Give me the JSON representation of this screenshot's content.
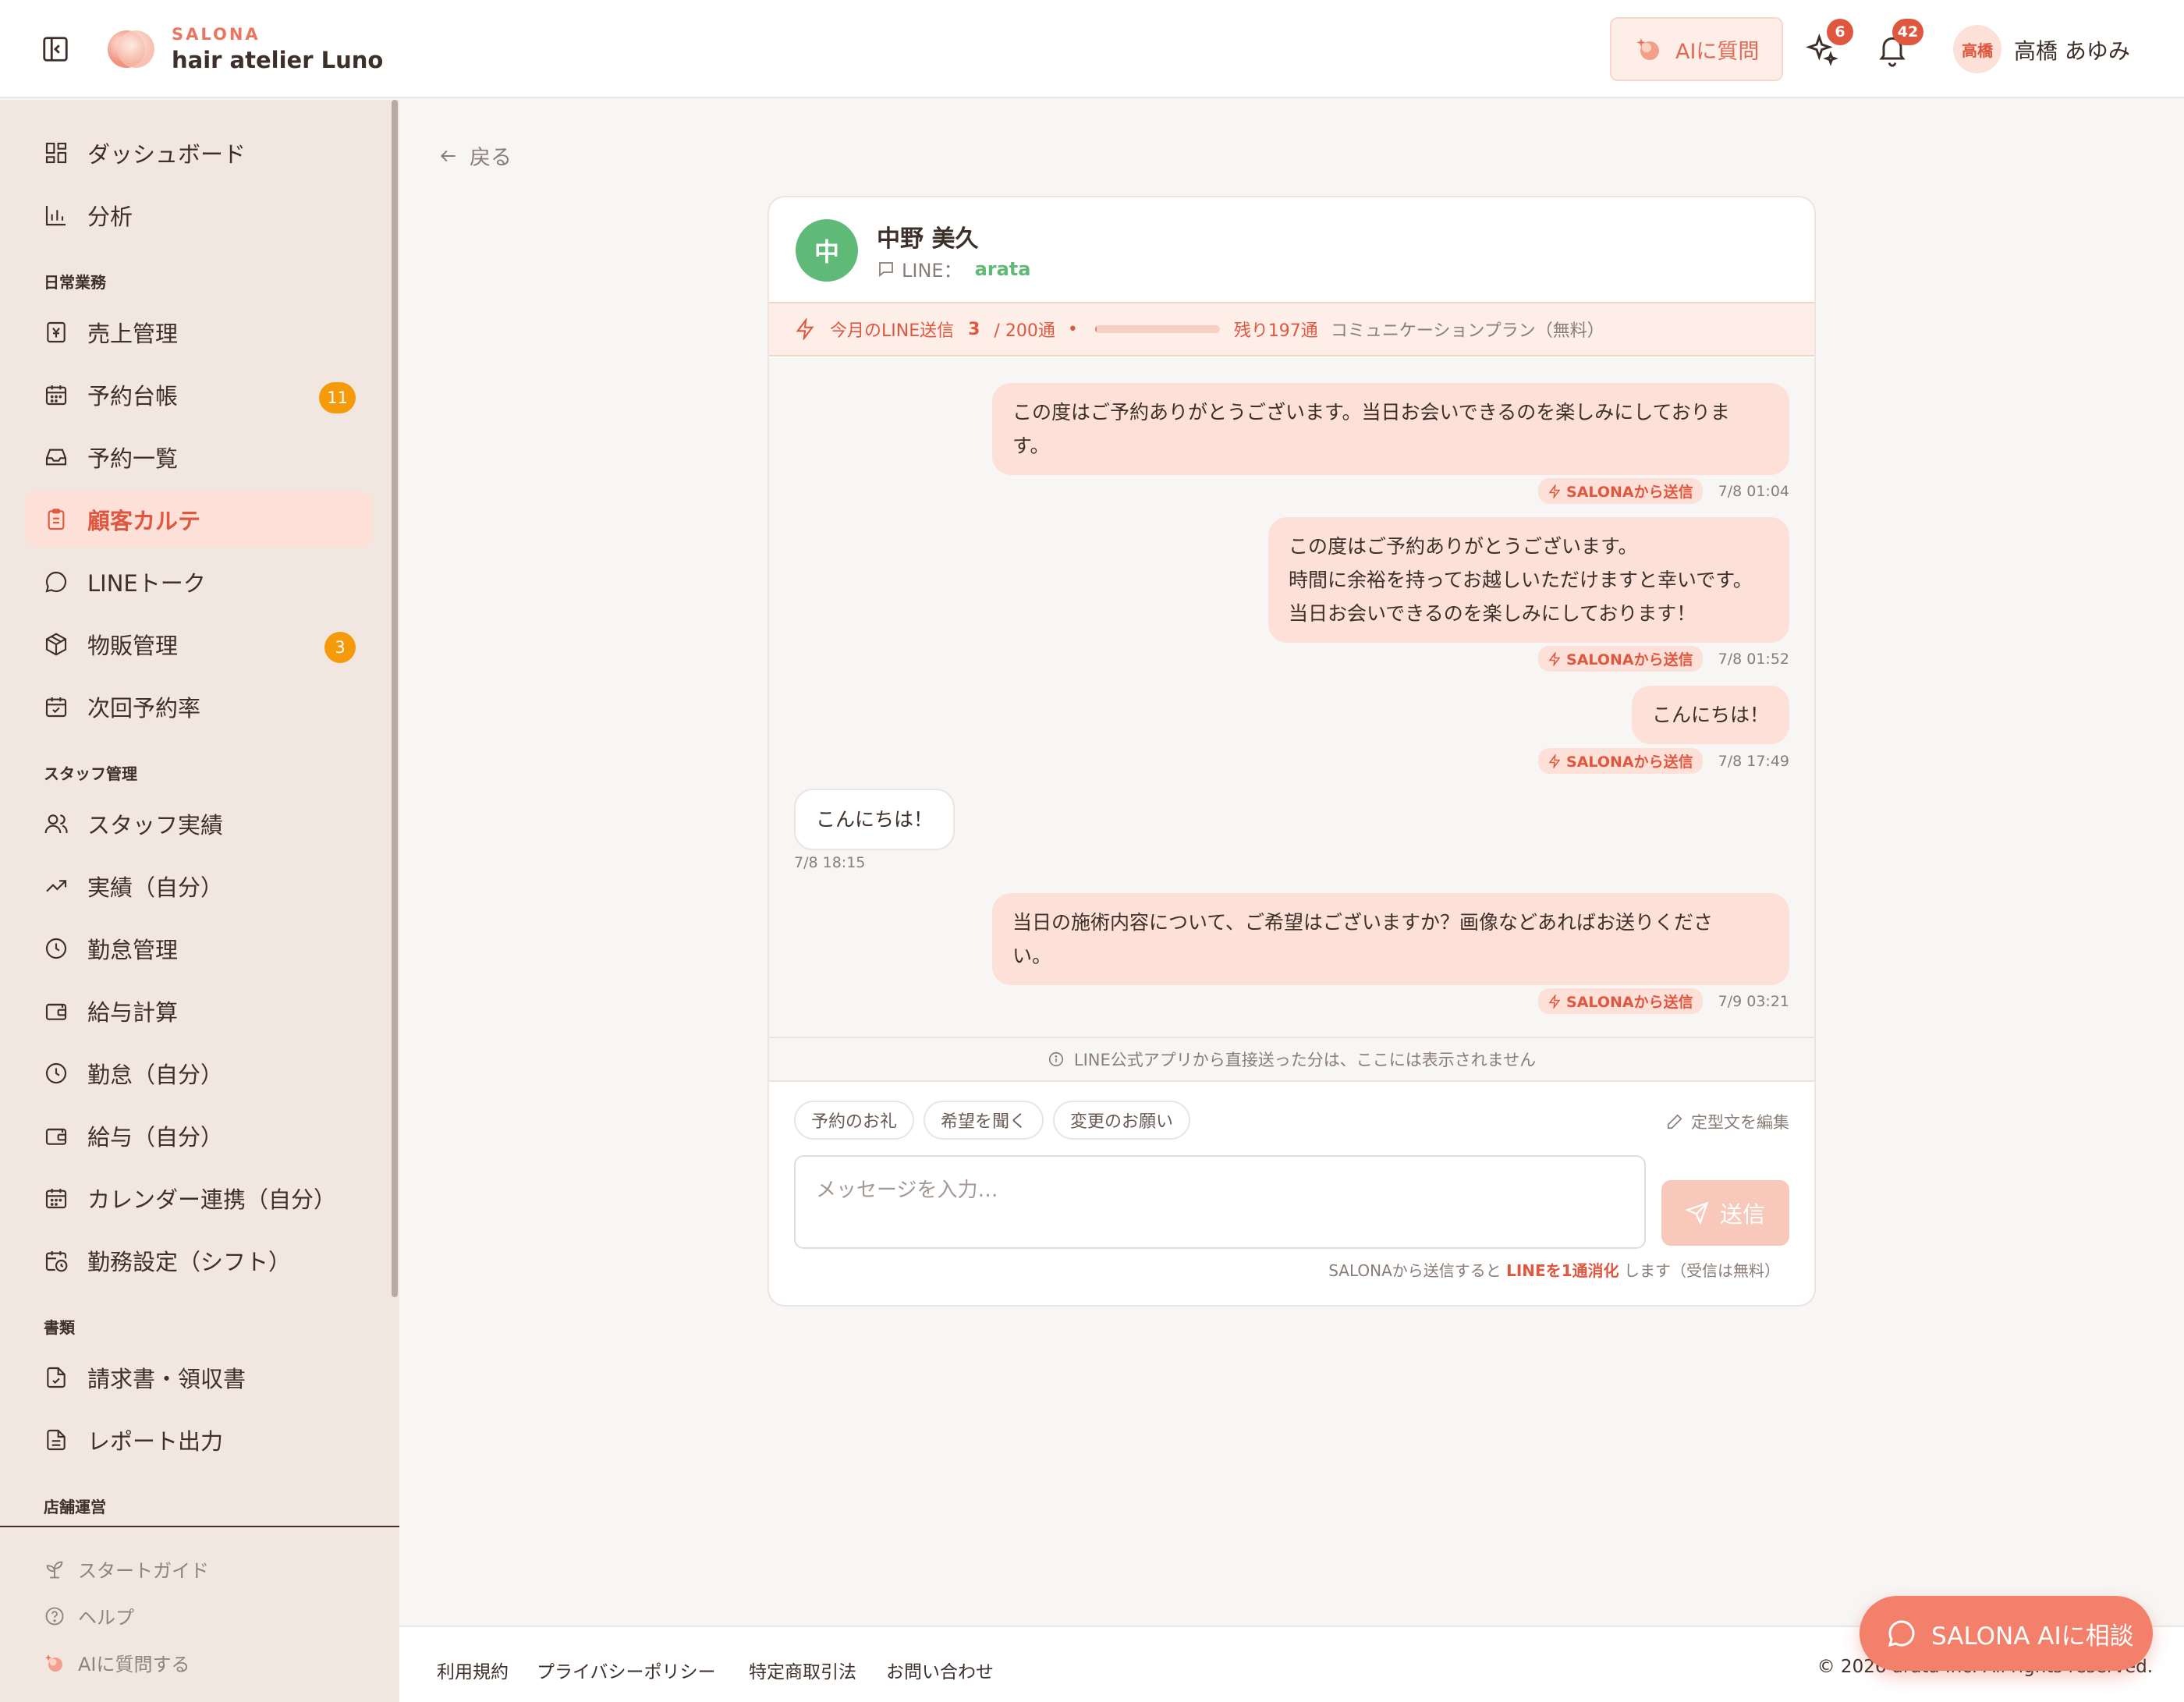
{
  "header": {
    "brand_small": "SALONA",
    "brand_name": "hair atelier Luno",
    "ai_button": "AIに質問",
    "sparkle_count": "6",
    "notification_count": "42",
    "user_avatar": "高橋",
    "user_name": "高橋 あゆみ"
  },
  "sidebar": {
    "items": [
      {
        "label": "ダッシュボード",
        "icon": "dashboard-icon"
      },
      {
        "label": "分析",
        "icon": "bar-chart-icon"
      },
      {
        "label": "売上管理",
        "icon": "receipt-icon"
      },
      {
        "label": "予約台帳",
        "icon": "calendar-icon",
        "badge": "11"
      },
      {
        "label": "予約一覧",
        "icon": "inbox-icon"
      },
      {
        "label": "顧客カルテ",
        "icon": "clipboard-icon",
        "active": true
      },
      {
        "label": "LINEトーク",
        "icon": "chat-bubble-icon"
      },
      {
        "label": "物販管理",
        "icon": "package-icon",
        "badge": "3"
      },
      {
        "label": "次回予約率",
        "icon": "calendar-check-icon"
      },
      {
        "label": "スタッフ実績",
        "icon": "users-icon"
      },
      {
        "label": "実績（自分）",
        "icon": "trending-up-icon"
      },
      {
        "label": "勤怠管理",
        "icon": "clock-icon"
      },
      {
        "label": "給与計算",
        "icon": "wallet-icon"
      },
      {
        "label": "勤怠（自分）",
        "icon": "clock-icon"
      },
      {
        "label": "給与（自分）",
        "icon": "wallet-icon"
      },
      {
        "label": "カレンダー連携（自分）",
        "icon": "calendar-icon"
      },
      {
        "label": "勤務設定（シフト）",
        "icon": "calendar-clock-icon"
      },
      {
        "label": "請求書・領収書",
        "icon": "file-check-icon"
      },
      {
        "label": "レポート出力",
        "icon": "file-text-icon"
      }
    ],
    "sections": {
      "daily": "日常業務",
      "staff": "スタッフ管理",
      "documents": "書類",
      "store": "店舗運営"
    },
    "footer": {
      "start_guide": "スタートガイド",
      "help": "ヘルプ",
      "ask_ai": "AIに質問する"
    }
  },
  "main": {
    "back": "戻る",
    "customer": {
      "avatar": "中",
      "name": "中野 美久",
      "line_label": "LINE：",
      "line_id": "arata"
    },
    "quota": {
      "label": "今月のLINE送信",
      "used": "3",
      "total": "/ 200通",
      "dot": "•",
      "used_fraction": 0.015,
      "remaining": "残り197通",
      "plan": "コミュニケーションプラン（無料）"
    },
    "messages": [
      {
        "dir": "out",
        "text": "この度はご予約ありがとうございます。当日お会いできるのを楽しみにしておりま\nす。",
        "tag": "SALONAから送信",
        "time": "7/8 01:04"
      },
      {
        "dir": "out",
        "text": "この度はご予約ありがとうございます。\n時間に余裕を持ってお越しいただけますと幸いです。\n当日お会いできるのを楽しみにしております！",
        "tag": "SALONAから送信",
        "time": "7/8 01:52"
      },
      {
        "dir": "out",
        "text": "こんにちは！",
        "tag": "SALONAから送信",
        "time": "7/8 17:49"
      },
      {
        "dir": "in",
        "text": "こんにちは！",
        "time": "7/8 18:15"
      },
      {
        "dir": "out",
        "text": "当日の施術内容について、ご希望はございますか？画像などあればお送りくださ\nい。",
        "tag": "SALONAから送信",
        "time": "7/9 03:21"
      }
    ],
    "notice": "LINE公式アプリから直接送った分は、ここには表示されません",
    "chips": [
      "予約のお礼",
      "希望を聞く",
      "変更のお願い"
    ],
    "edit_templates": "定型文を編集",
    "input_placeholder": "メッセージを入力…",
    "send": "送信",
    "send_note_pre": "SALONAから送信すると",
    "send_note_bold": "LINEを1通消化",
    "send_note_post": "します（受信は無料）"
  },
  "footer": {
    "links": [
      "利用規約",
      "プライバシーポリシー",
      "特定商取引法",
      "お問い合わせ"
    ],
    "copyright": "© 2026 arata Inc. All rights reserved."
  },
  "fab": {
    "label": "SALONA AIに相談"
  },
  "colors": {
    "accent": "#e0573f",
    "accent_soft": "#fde1d8",
    "sidebar_bg": "#f2e6e0",
    "line_green": "#5fba78",
    "badge_orange": "#f59b0b"
  }
}
